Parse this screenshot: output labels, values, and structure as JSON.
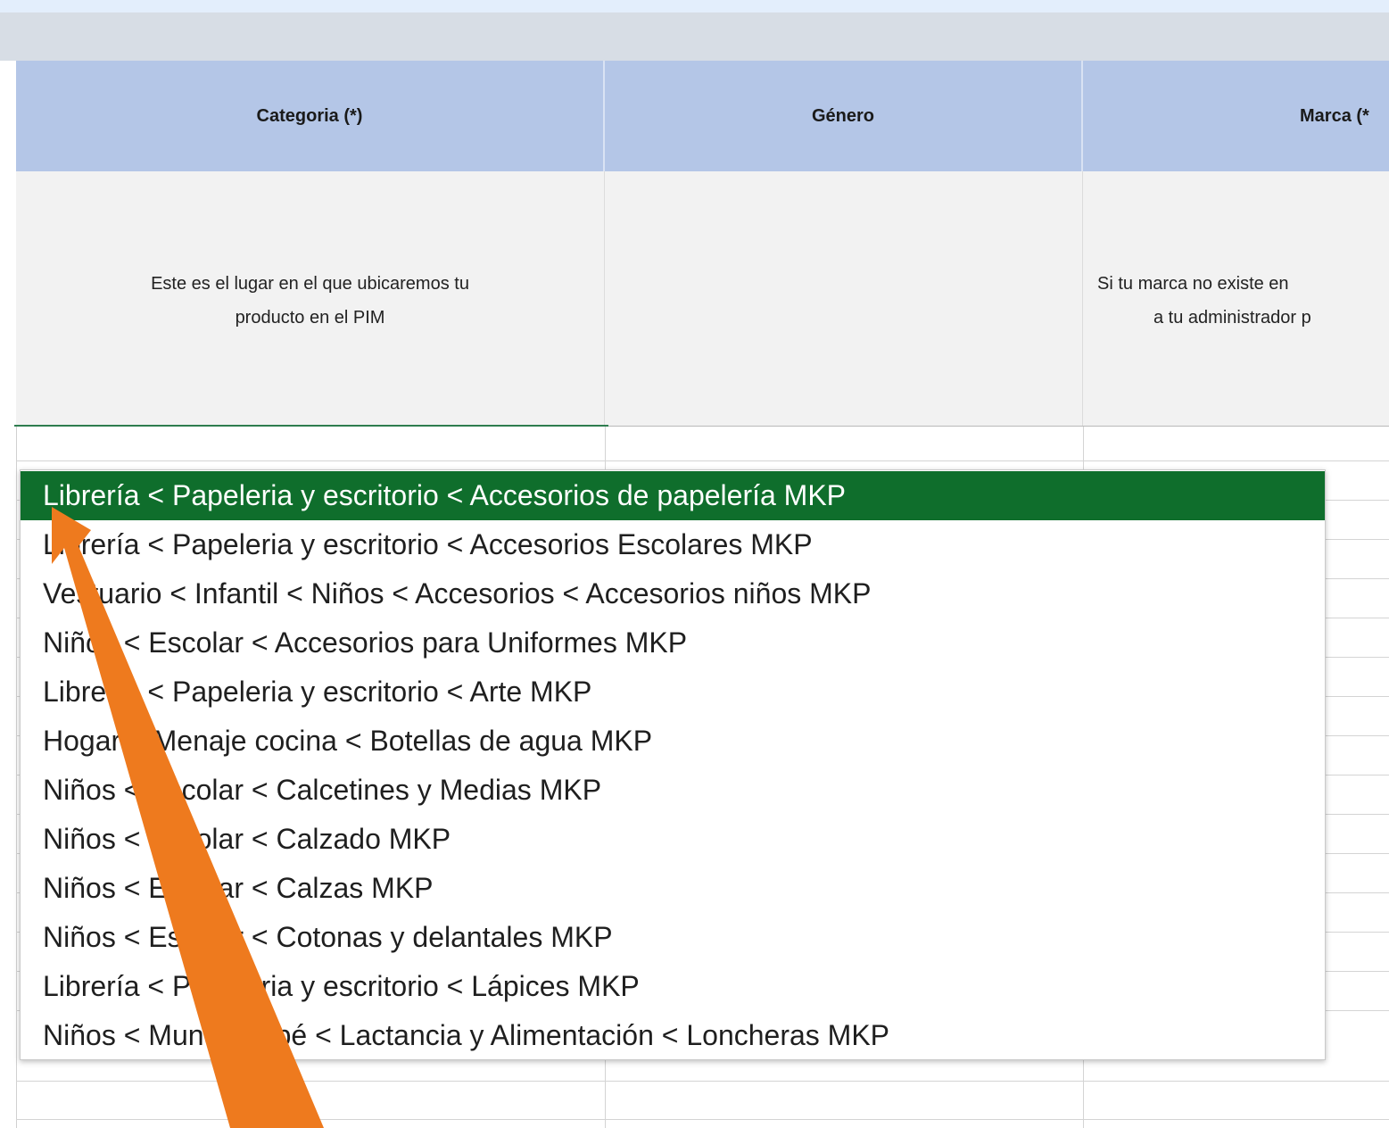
{
  "headers": {
    "categoria": "Categoria (*)",
    "genero": "Género",
    "marca": "Marca (*"
  },
  "descriptions": {
    "categoria_line1": "Este es el lugar en el que ubicaremos tu",
    "categoria_line2": "producto en el PIM",
    "marca_line1": "Si tu marca no existe en",
    "marca_line2": "a tu administrador p"
  },
  "dropdown": {
    "selected_index": 0,
    "options": [
      "Librería < Papeleria y escritorio < Accesorios de papelería MKP",
      "Librería < Papeleria y escritorio < Accesorios Escolares MKP",
      "Vestuario < Infantil < Niños < Accesorios < Accesorios niños MKP",
      "Niños < Escolar < Accesorios para Uniformes MKP",
      "Librería < Papeleria y escritorio < Arte MKP",
      "Hogar < Menaje cocina < Botellas de agua MKP",
      "Niños < Escolar < Calcetines y Medias MKP",
      "Niños < Escolar < Calzado MKP",
      "Niños < Escolar < Calzas MKP",
      "Niños < Escolar < Cotonas y delantales MKP",
      "Librería < Papeleria y escritorio < Lápices MKP",
      "Niños < Mundo bebé < Lactancia y Alimentación < Loncheras MKP"
    ]
  },
  "colors": {
    "header_bg": "#b4c6e7",
    "selected_bg": "#0f6e2c",
    "arrow": "#ee7a1e"
  },
  "annotation": {
    "icon": "arrow-annotation-icon"
  }
}
